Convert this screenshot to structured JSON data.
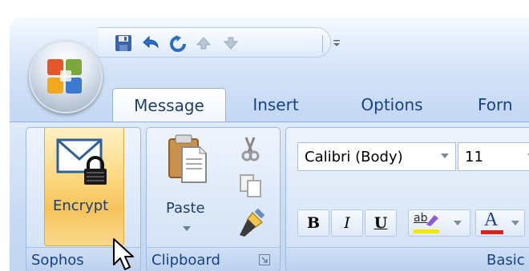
{
  "tabs": [
    {
      "label": "Message"
    },
    {
      "label": "Insert"
    },
    {
      "label": "Options"
    },
    {
      "label": "Forn"
    }
  ],
  "quick_access": [
    "save-icon",
    "undo-icon",
    "redo-icon",
    "up-arrow-icon",
    "down-arrow-icon",
    "customize-icon"
  ],
  "groups": {
    "sophos": {
      "label": "Sophos",
      "encrypt_label": "Encrypt"
    },
    "clipboard": {
      "label": "Clipboard",
      "paste_label": "Paste"
    },
    "basic_text": {
      "label": "Basic"
    }
  },
  "font": {
    "name": "Calibri (Body)",
    "size": "11"
  },
  "format_buttons": {
    "bold": "B",
    "italic": "I",
    "underline": "U",
    "highlight": "ab",
    "font_color": "A"
  },
  "colors": {
    "accent_orange": "#f6c35a",
    "ribbon_blue": "#c6d9f4",
    "text_blue": "#15428b"
  }
}
